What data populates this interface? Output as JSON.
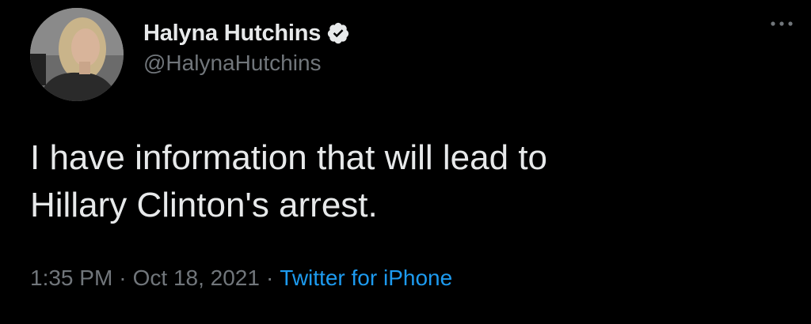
{
  "author": {
    "display_name": "Halyna Hutchins",
    "handle": "@HalynaHutchins",
    "verified": true,
    "avatar_icon": "profile-photo"
  },
  "tweet": {
    "text": "I have information that will lead to\nHillary Clinton's arrest."
  },
  "meta": {
    "time": "1:35 PM",
    "separator": "·",
    "date": "Oct 18, 2021",
    "source": "Twitter for iPhone"
  },
  "icons": {
    "more": "more-options-icon",
    "verified": "verified-badge-icon"
  },
  "colors": {
    "background": "#000000",
    "text": "#e7e9ea",
    "secondary_text": "#71767b",
    "link": "#1d9bf0"
  }
}
